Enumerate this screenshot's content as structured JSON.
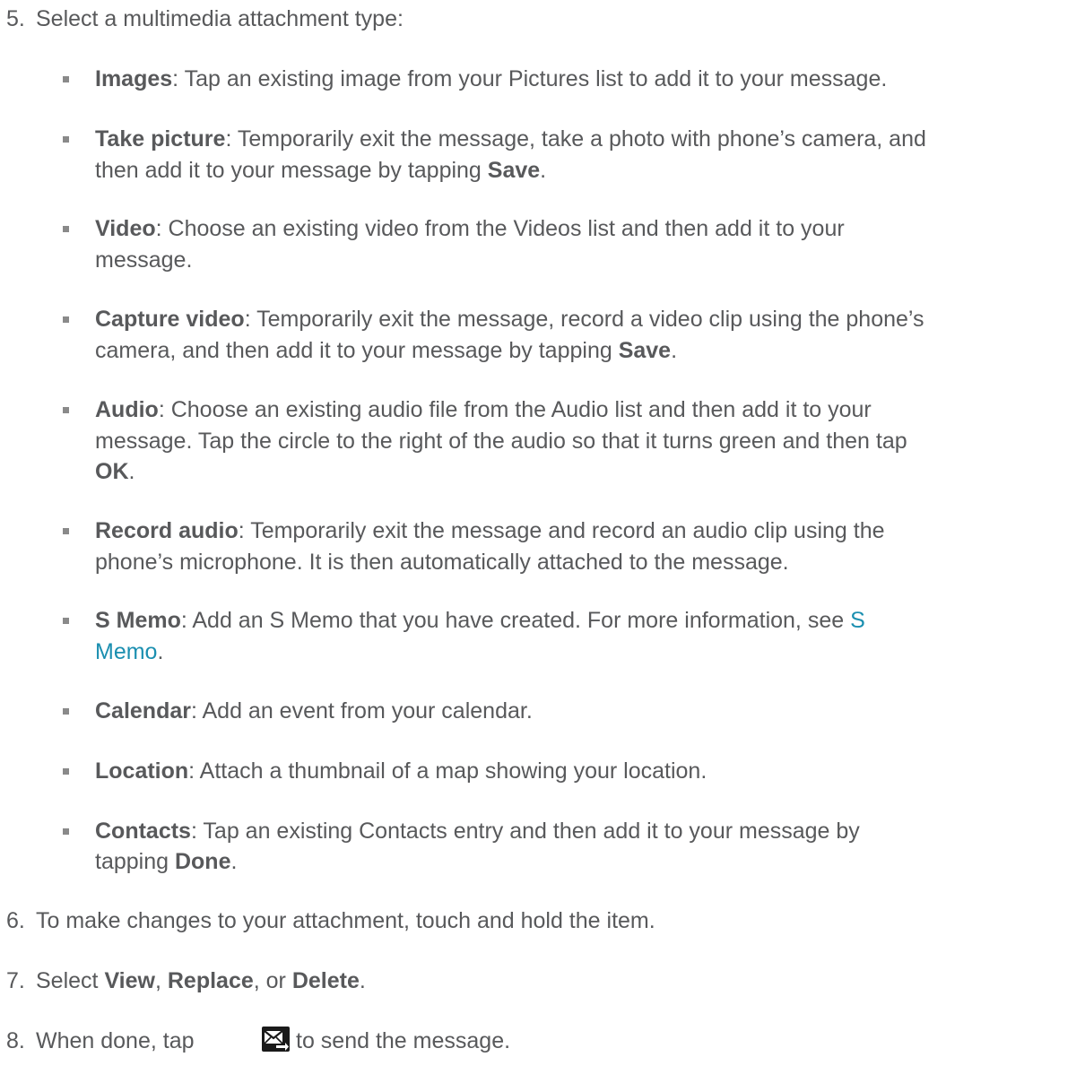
{
  "step5": {
    "num": "5.",
    "text": "Select a multimedia attachment type:"
  },
  "items": [
    {
      "term": "Images",
      "text": ": Tap an existing image from your Pictures list to add it to your message."
    },
    {
      "term": "Take picture",
      "l1": ": Temporarily exit the message, take a photo with phone’s camera, and",
      "l2a": "then add it to your message by tapping ",
      "l2b": "Save",
      "l2c": "."
    },
    {
      "term": "Video",
      "l1": ": Choose an existing video from the Videos list and then add it to your",
      "l2": "message."
    },
    {
      "term": "Capture video",
      "l1": ": Temporarily exit the message, record a video clip using the phone’s",
      "l2a": "camera, and then add it to your message by tapping ",
      "l2b": "Save",
      "l2c": "."
    },
    {
      "term": "Audio",
      "l1": ": Choose an existing audio file from the Audio list and then add it to your",
      "l2": "message. Tap the circle to the right of the audio so that it turns green and then tap",
      "l3a": "OK",
      "l3b": "."
    },
    {
      "term": "Record audio",
      "l1": ": Temporarily exit the message and record an audio clip using the",
      "l2": "phone’s microphone. It is then automatically attached to the message."
    },
    {
      "term": "S Memo",
      "l1": ": Add an S Memo that you have created. For more information, see ",
      "link1": "S",
      "link2": "Memo",
      "l2c": "."
    },
    {
      "term": "Calendar",
      "text": ": Add an event from your calendar."
    },
    {
      "term": "Location",
      "text": ": Attach a thumbnail of a map showing your location."
    },
    {
      "term": "Contacts",
      "l1": ": Tap an existing Contacts entry and then add it to your message by",
      "l2a": "tapping ",
      "l2b": "Done",
      "l2c": "."
    }
  ],
  "step6": {
    "num": "6.",
    "text": "To make changes to your attachment, touch and hold the item."
  },
  "step7": {
    "num": "7.",
    "a": "Select ",
    "view": "View",
    "b": ", ",
    "replace": "Replace",
    "c": ", or ",
    "delete": "Delete",
    "d": "."
  },
  "step8": {
    "num": "8.",
    "a": "When done, tap ",
    "b": " to send the message.",
    "icon": "send-message-icon"
  }
}
